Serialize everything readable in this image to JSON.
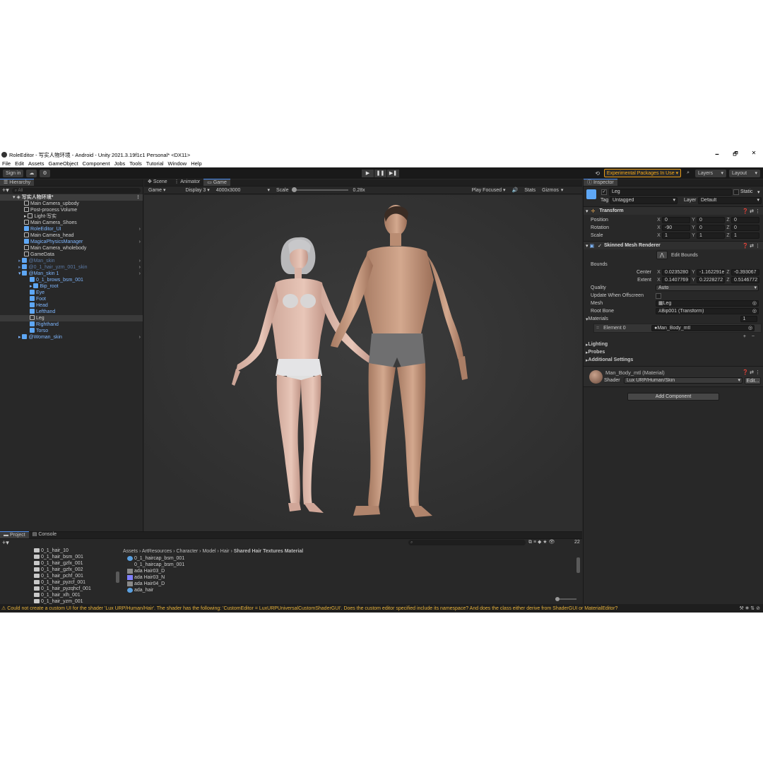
{
  "window": {
    "title": "RoleEditor - 写实人物环境 - Android - Unity 2021.3.19f1c1 Personal* <DX11>",
    "minimize": "🗕",
    "maximize": "🗗",
    "close": "✕"
  },
  "menu": [
    "File",
    "Edit",
    "Assets",
    "GameObject",
    "Component",
    "Jobs",
    "Tools",
    "Tutorial",
    "Window",
    "Help"
  ],
  "toolbar": {
    "sign_in": "Sign in",
    "play": "▶",
    "pause": "❚❚",
    "step": "▶❚",
    "experimental": "Experimental Packages In Use ▾",
    "layers": "Layers",
    "layout": "Layout"
  },
  "hierarchy": {
    "tab": "Hierarchy",
    "search_placeholder": "All",
    "root": "写实人物环境*",
    "items": [
      {
        "label": "Main Camera_upbody",
        "style": "normal"
      },
      {
        "label": "Post-process Volume",
        "style": "normal"
      },
      {
        "label": "Light-写实",
        "style": "normal"
      },
      {
        "label": "Main Camera_Shoes",
        "style": "normal"
      },
      {
        "label": "RoleEditor_UI",
        "style": "prefab"
      },
      {
        "label": "Main Camera_head",
        "style": "normal"
      },
      {
        "label": "MagicaPhysicsManager",
        "style": "prefab"
      },
      {
        "label": "Main Camera_wholebody",
        "style": "normal"
      },
      {
        "label": "GameData",
        "style": "normal"
      },
      {
        "label": "@Man_skin",
        "style": "dim"
      },
      {
        "label": "@0_1_hair_yzm_001_skin",
        "style": "dim"
      },
      {
        "label": "@Man_skin 1",
        "style": "prefab"
      },
      {
        "label": "0_1_brows_bsm_001",
        "style": "prefab"
      },
      {
        "label": "Bip_root",
        "style": "prefab"
      },
      {
        "label": "Eye",
        "style": "prefab"
      },
      {
        "label": "Foot",
        "style": "prefab"
      },
      {
        "label": "Head",
        "style": "prefab"
      },
      {
        "label": "Lefthand",
        "style": "prefab"
      },
      {
        "label": "Leg",
        "style": "selected"
      },
      {
        "label": "Righthand",
        "style": "prefab"
      },
      {
        "label": "Torso",
        "style": "prefab"
      },
      {
        "label": "@Woman_skin",
        "style": "prefab"
      }
    ]
  },
  "game": {
    "tabs": [
      "Scene",
      "Animator",
      "Game"
    ],
    "mode": "Game",
    "display": "Display 3",
    "resolution": "4000x3000",
    "scale_label": "Scale",
    "scale_value": "0.28x",
    "play_focused": "Play Focused",
    "stats": "Stats",
    "gizmos": "Gizmos"
  },
  "inspector": {
    "tab": "Inspector",
    "object_name": "Leg",
    "static_label": "Static",
    "tag_label": "Tag",
    "tag_value": "Untagged",
    "layer_label": "Layer",
    "layer_value": "Default",
    "transform": {
      "title": "Transform",
      "rows": [
        {
          "label": "Position",
          "x": "0",
          "y": "0",
          "z": "0"
        },
        {
          "label": "Rotation",
          "x": "-90",
          "y": "0",
          "z": "0"
        },
        {
          "label": "Scale",
          "x": "1",
          "y": "1",
          "z": "1"
        }
      ]
    },
    "smr": {
      "title": "Skinned Mesh Renderer",
      "edit_bounds": "Edit Bounds",
      "bounds_label": "Bounds",
      "center_label": "Center",
      "center": {
        "x": "0.0235280",
        "y": "-1.162291e",
        "z": "-0.393067"
      },
      "extent_label": "Extent",
      "extent": {
        "x": "0.1407769",
        "y": "0.2228272",
        "z": "0.5146772"
      },
      "quality_label": "Quality",
      "quality_value": "Auto",
      "offscreen_label": "Update When Offscreen",
      "mesh_label": "Mesh",
      "mesh_value": "Leg",
      "rootbone_label": "Root Bone",
      "rootbone_value": "Bip001 (Transform)",
      "materials_label": "Materials",
      "materials_count": "1",
      "element_label": "Element 0",
      "element_value": "Man_Body_mtl",
      "lighting": "Lighting",
      "probes": "Probes",
      "additional": "Additional Settings"
    },
    "material": {
      "name": "Man_Body_mtl (Material)",
      "shader_label": "Shader",
      "shader_value": "Lux URP/Human/Skin",
      "edit": "Edit..."
    },
    "add_component": "Add Component"
  },
  "project": {
    "tabs": [
      "Project",
      "Console"
    ],
    "folders": [
      "0_1_hair_10",
      "0_1_hair_bsm_001",
      "0_1_hair_gzfx_001",
      "0_1_hair_gzfx_002",
      "0_1_hair_pchf_001",
      "0_1_hair_pyzcf_001",
      "0_1_hair_pyzqhcf_001",
      "0_1_hair_xlh_001",
      "0_1_hair_yzm_001"
    ],
    "breadcrumb": [
      "Assets",
      "ArtResources",
      "Character",
      "Model",
      "Hair",
      "Shared Hair Textures Material"
    ],
    "assets": [
      {
        "label": "0_1_haircap_bsm_001",
        "color": "#5aa0e0"
      },
      {
        "label": "0_1_haircap_bsm_001",
        "color": "#2a2a2a"
      },
      {
        "label": "ada Hair03_D",
        "color": "#8a8a8a"
      },
      {
        "label": "ada Hair03_N",
        "color": "#8080ff"
      },
      {
        "label": "ada Hair04_D",
        "color": "#8a8a8a"
      },
      {
        "label": "ada_hair",
        "color": "#5aa0e0"
      }
    ],
    "count": "22"
  },
  "status": {
    "message": "Could not create a custom UI for the shader 'Lux URP/Human/Hair'. The shader has the following: 'CustomEditor = LuxURPUniversalCustomShaderGUI'. Does the custom editor specified include its namespace? And does the class either derive from ShaderGUI or MaterialEditor?"
  },
  "colors": {
    "accent": "#4b8ef2",
    "prefab": "#7fb7ff",
    "warning": "#e8b23a",
    "experimental": "#f2a616"
  }
}
